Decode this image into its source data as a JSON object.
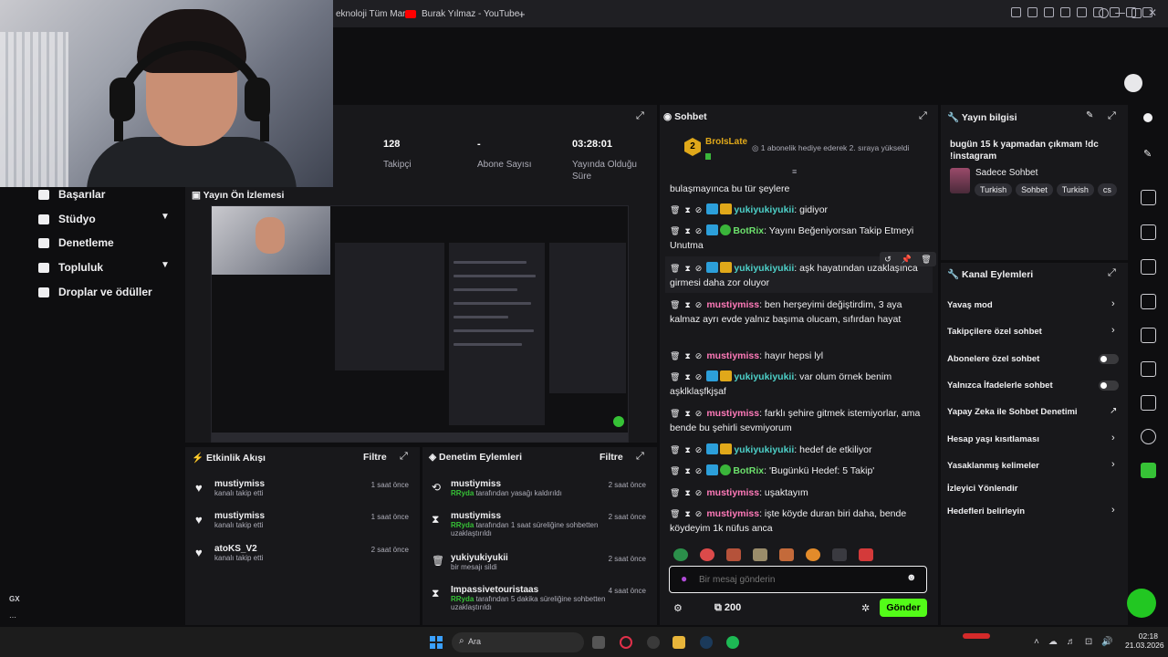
{
  "browser": {
    "tabs": [
      {
        "label": "eknoloji Tüm Mar",
        "color": "#e03a3a"
      },
      {
        "label": "Burak Yılmaz - YouTube",
        "color": "#ff0000"
      }
    ],
    "new_tab": "+"
  },
  "nav": {
    "items": [
      {
        "label": "Başarılar"
      },
      {
        "label": "Stüdyo",
        "chevron": "⌄"
      },
      {
        "label": "Denetleme"
      },
      {
        "label": "Topluluk",
        "chevron": "⌄"
      },
      {
        "label": "Droplar ve ödüller"
      }
    ]
  },
  "stats": {
    "followers_value": "128",
    "followers_label": "Takipçi",
    "subs_value": "-",
    "subs_label": "Abone Sayısı",
    "duration_value": "03:28:01",
    "duration_label": "Yayında Olduğu Süre"
  },
  "preview": {
    "title": "Yayın Ön İzlemesi"
  },
  "activity": {
    "title": "Etkinlik Akışı",
    "filter": "Filtre",
    "items": [
      {
        "name": "mustiymiss",
        "sub": "kanalı takip etti",
        "time": "1 saat önce"
      },
      {
        "name": "mustiymiss",
        "sub": "kanalı takip etti",
        "time": "1 saat önce"
      },
      {
        "name": "atoKS_V2",
        "sub": "kanalı takip etti",
        "time": "2 saat önce"
      }
    ]
  },
  "moderation": {
    "title": "Denetim Eylemleri",
    "filter": "Filtre",
    "items": [
      {
        "icon": "⟲",
        "name": "mustiymiss",
        "actor": "RRyda",
        "sub": "tarafından yasağı kaldırıldı",
        "time": "2 saat önce"
      },
      {
        "icon": "⧗",
        "name": "mustiymiss",
        "actor": "RRyda",
        "sub": "tarafından 1 saat süreliğine sohbetten uzaklaştırıldı",
        "time": "2 saat önce"
      },
      {
        "icon": "🗑",
        "name": "yukiyukiyukii",
        "actor": "",
        "sub": "bir mesajı sildi",
        "time": "2 saat önce"
      },
      {
        "icon": "⧗",
        "name": "Impassivetouristaas",
        "actor": "RRyda",
        "sub": "tarafından 5 dakika süreliğine sohbetten uzaklaştırıldı",
        "time": "4 saat önce"
      }
    ]
  },
  "chat": {
    "title": "Sohbet",
    "pinned_user": "BroIsLate",
    "pinned_rank": "2",
    "pinned_msg": "1 abonelik hediye ederek 2. sıraya yükseldi",
    "messages": [
      {
        "user": "",
        "text": "bulaşmayınca bu tür şeylere",
        "badges": []
      },
      {
        "user": "yukiyukiyukii",
        "text": ": gidiyor",
        "badges": [
          "blue",
          "crown"
        ],
        "color": "cyan"
      },
      {
        "user": "BotRix",
        "text": ": Yayını Beğeniyorsan Takip Etmeyi Unutma",
        "badges": [
          "blue",
          "green"
        ],
        "color": "green"
      },
      {
        "user": "yukiyukiyukii",
        "text": ": aşk hayatından uzaklaşınca girmesi daha zor oluyor",
        "badges": [
          "blue",
          "crown"
        ],
        "color": "cyan"
      },
      {
        "user": "mustiymiss",
        "text": ": ben herşeyimi değiştirdim, 3 aya kalmaz ayrı evde yalnız başıma olucam, sıfırdan hayat",
        "badges": [],
        "color": "pink"
      },
      {
        "user": "mustiymiss",
        "text": ": hayır hepsi lyl",
        "badges": [],
        "color": "pink"
      },
      {
        "user": "yukiyukiyukii",
        "text": ": var olum örnek benim aşklklaşfkjşaf",
        "badges": [
          "blue",
          "crown"
        ],
        "color": "cyan"
      },
      {
        "user": "mustiymiss",
        "text": ": farklı şehire gitmek istemiyorlar, ama bende bu şehirli sevmiyorum",
        "badges": [],
        "color": "pink"
      },
      {
        "user": "yukiyukiyukii",
        "text": ": hedef de etkiliyor",
        "badges": [
          "blue",
          "crown"
        ],
        "color": "cyan"
      },
      {
        "user": "BotRix",
        "text": ": 'Bugünkü Hedef: 5 Takip'",
        "badges": [
          "blue",
          "green"
        ],
        "color": "green"
      },
      {
        "user": "mustiymiss",
        "text": ": uşaktayım",
        "badges": [],
        "color": "pink"
      },
      {
        "user": "mustiymiss",
        "text": ": işte köyde duran biri daha, bende köydeyim 1k nüfus anca",
        "badges": [],
        "color": "pink"
      }
    ],
    "input_placeholder": "Bir mesaj gönderin",
    "points": "200",
    "send": "Gönder"
  },
  "stream_info": {
    "title": "Yayın bilgisi",
    "stream_title": "bugün 15 k yapmadan çıkmam !dc !instagram",
    "chat_mode": "Sadece Sohbet",
    "tags": [
      "Turkish",
      "Sohbet",
      "Turkish",
      "cs"
    ]
  },
  "channel_actions": {
    "title": "Kanal Eylemleri",
    "items": [
      {
        "label": "Yavaş mod",
        "control": "chevron"
      },
      {
        "label": "Takipçilere özel sohbet",
        "control": "chevron"
      },
      {
        "label": "Abonelere özel sohbet",
        "control": "toggle"
      },
      {
        "label": "Yalnızca İfadelerle sohbet",
        "control": "toggle"
      },
      {
        "label": "Yapay Zeka ile Sohbet Denetimi",
        "control": "external"
      },
      {
        "label": "Hesap yaşı kısıtlaması",
        "control": "chevron"
      },
      {
        "label": "Yasaklanmış kelimeler",
        "control": "chevron"
      },
      {
        "label": "İzleyici Yönlendir",
        "control": "none"
      },
      {
        "label": "Hedefleri belirleyin",
        "control": "chevron"
      }
    ]
  },
  "taskbar": {
    "search": "Ara",
    "time": "02:18",
    "date": "21.03.2026",
    "gx": "GX"
  },
  "colors": {
    "accent": "#53fc18",
    "panel": "#18181b",
    "bg": "#0e0e10"
  }
}
